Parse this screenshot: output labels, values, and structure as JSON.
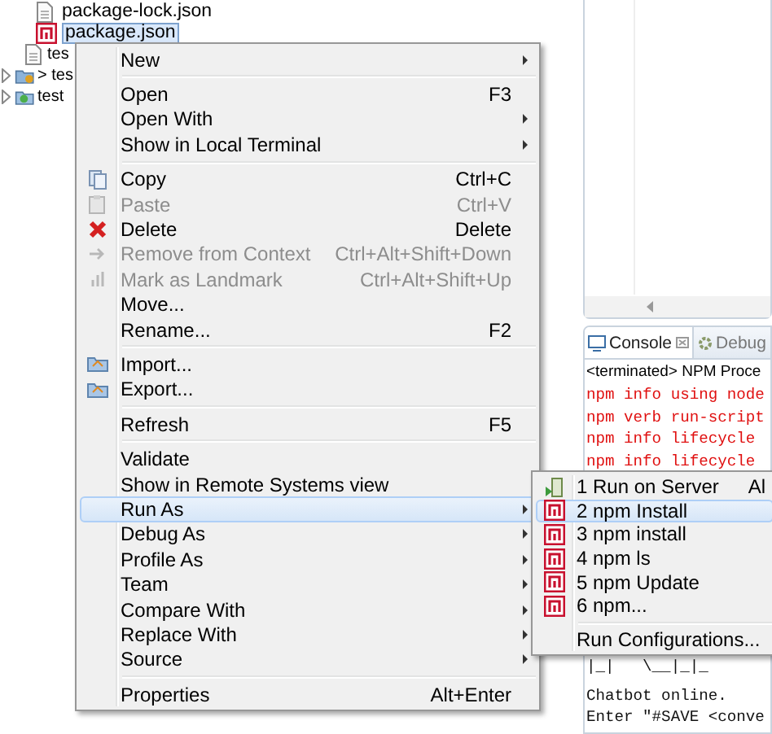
{
  "tree": {
    "files": [
      {
        "label": "package-lock.json",
        "kind": "file",
        "selected": false
      },
      {
        "label": "package.json",
        "kind": "npm",
        "selected": true
      },
      {
        "label": "tes",
        "kind": "file",
        "selected": false
      }
    ],
    "projects": [
      {
        "label": "> tes",
        "kind": "web",
        "expanded": false
      },
      {
        "label": "test",
        "kind": "folder",
        "expanded": false
      }
    ]
  },
  "console": {
    "tabs": [
      {
        "label": "Console",
        "selected": true
      },
      {
        "label": "Debug",
        "selected": false
      }
    ],
    "header": "<terminated> NPM Proce",
    "output_top": [
      {
        "text": "npm info using node",
        "kind": "error"
      },
      {
        "text": "npm verb run-script",
        "kind": "error"
      },
      {
        "text": "npm info lifecycle",
        "kind": "error"
      },
      {
        "text": "npm info lifecycle",
        "kind": "error"
      }
    ],
    "banner": "|_|   \\__|_|_",
    "output_bottom": [
      "Chatbot online.",
      "Enter \"#SAVE <conve"
    ]
  },
  "context_menu": {
    "items": [
      {
        "kind": "item",
        "label": "New",
        "disabled": false,
        "has_submenu": true,
        "selected": false
      },
      {
        "kind": "separator"
      },
      {
        "kind": "item",
        "label": "Open",
        "shortcut": "F3",
        "disabled": false,
        "has_submenu": false,
        "selected": false
      },
      {
        "kind": "item",
        "label": "Open With",
        "disabled": false,
        "has_submenu": true,
        "selected": false
      },
      {
        "kind": "item",
        "label": "Show in Local Terminal",
        "disabled": false,
        "has_submenu": true,
        "selected": false
      },
      {
        "kind": "separator"
      },
      {
        "kind": "item",
        "label": "Copy",
        "shortcut": "Ctrl+C",
        "disabled": false,
        "has_submenu": false,
        "selected": false
      },
      {
        "kind": "item",
        "label": "Paste",
        "shortcut": "Ctrl+V",
        "disabled": true,
        "has_submenu": false,
        "selected": false
      },
      {
        "kind": "item",
        "label": "Delete",
        "shortcut": "Delete",
        "disabled": false,
        "has_submenu": false,
        "selected": false
      },
      {
        "kind": "item",
        "label": "Remove from Context",
        "shortcut": "Ctrl+Alt+Shift+Down",
        "disabled": true,
        "has_submenu": false,
        "selected": false
      },
      {
        "kind": "item",
        "label": "Mark as Landmark",
        "shortcut": "Ctrl+Alt+Shift+Up",
        "disabled": true,
        "has_submenu": false,
        "selected": false
      },
      {
        "kind": "item",
        "label": "Move...",
        "disabled": false,
        "has_submenu": false,
        "selected": false
      },
      {
        "kind": "item",
        "label": "Rename...",
        "shortcut": "F2",
        "disabled": false,
        "has_submenu": false,
        "selected": false
      },
      {
        "kind": "separator"
      },
      {
        "kind": "item",
        "label": "Import...",
        "disabled": false,
        "has_submenu": false,
        "selected": false
      },
      {
        "kind": "item",
        "label": "Export...",
        "disabled": false,
        "has_submenu": false,
        "selected": false
      },
      {
        "kind": "separator"
      },
      {
        "kind": "item",
        "label": "Refresh",
        "shortcut": "F5",
        "disabled": false,
        "has_submenu": false,
        "selected": false
      },
      {
        "kind": "separator"
      },
      {
        "kind": "item",
        "label": "Validate",
        "disabled": false,
        "has_submenu": false,
        "selected": false
      },
      {
        "kind": "item",
        "label": "Show in Remote Systems view",
        "disabled": false,
        "has_submenu": false,
        "selected": false
      },
      {
        "kind": "item",
        "label": "Run As",
        "disabled": false,
        "has_submenu": true,
        "selected": true
      },
      {
        "kind": "item",
        "label": "Debug As",
        "disabled": false,
        "has_submenu": true,
        "selected": false
      },
      {
        "kind": "item",
        "label": "Profile As",
        "disabled": false,
        "has_submenu": true,
        "selected": false
      },
      {
        "kind": "item",
        "label": "Team",
        "disabled": false,
        "has_submenu": true,
        "selected": false
      },
      {
        "kind": "item",
        "label": "Compare With",
        "disabled": false,
        "has_submenu": true,
        "selected": false
      },
      {
        "kind": "item",
        "label": "Replace With",
        "disabled": false,
        "has_submenu": true,
        "selected": false
      },
      {
        "kind": "item",
        "label": "Source",
        "disabled": false,
        "has_submenu": true,
        "selected": false
      },
      {
        "kind": "separator"
      },
      {
        "kind": "item",
        "label": "Properties",
        "shortcut": "Alt+Enter",
        "disabled": false,
        "has_submenu": false,
        "selected": false
      }
    ]
  },
  "run_as_menu": {
    "items": [
      {
        "kind": "server",
        "label": "1 Run on Server",
        "shortcut": "Al",
        "selected": false
      },
      {
        "kind": "npm",
        "label": "2 npm Install",
        "selected": true
      },
      {
        "kind": "npm",
        "label": "3 npm install",
        "selected": false
      },
      {
        "kind": "npm",
        "label": "4 npm ls",
        "selected": false
      },
      {
        "kind": "npm",
        "label": "5 npm Update",
        "selected": false
      },
      {
        "kind": "npm",
        "label": "6 npm...",
        "selected": false
      },
      {
        "kind": "separator"
      },
      {
        "kind": "plain",
        "label": "Run Configurations...",
        "selected": false
      }
    ]
  }
}
